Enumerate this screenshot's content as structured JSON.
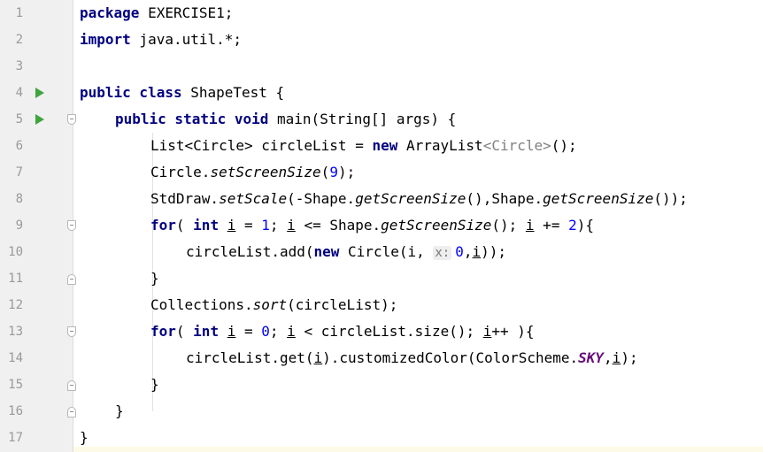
{
  "editor": {
    "language": "java",
    "gutter": {
      "line_numbers": [
        "1",
        "2",
        "3",
        "4",
        "5",
        "6",
        "7",
        "8",
        "9",
        "10",
        "11",
        "12",
        "13",
        "14",
        "15",
        "16",
        "17"
      ],
      "run_markers": [
        "run-icon",
        "run-icon"
      ],
      "fold_markers": [
        "fold-open-icon",
        "fold-open-icon",
        "fold-close-icon",
        "fold-open-icon",
        "fold-close-icon",
        "fold-close-icon",
        "fold-close-icon"
      ]
    },
    "inlay_hint": "x:",
    "code": {
      "l1_kw": "package",
      "l1_rest": " EXERCISE1;",
      "l2_kw": "import",
      "l2_rest": " java.util.*;",
      "l4_kw": "public class",
      "l4_rest": " ShapeTest {",
      "l5_kw": "public static void",
      "l5_rest": " main(String[] args) {",
      "l6_a": "List<Circle> circleList = ",
      "l6_kw": "new",
      "l6_b": " ArrayList",
      "l6_type": "<Circle>",
      "l6_c": "();",
      "l7_a": "Circle.",
      "l7_it": "setScreenSize",
      "l7_b": "(",
      "l7_num": "9",
      "l7_c": ");",
      "l8_a": "StdDraw.",
      "l8_it1": "setScale",
      "l8_b": "(-Shape.",
      "l8_it2": "getScreenSize",
      "l8_c": "(),Shape.",
      "l8_it3": "getScreenSize",
      "l8_d": "());",
      "l9_kw1": "for",
      "l9_a": "( ",
      "l9_kw2": "int",
      "l9_b": " ",
      "l9_var1": "i",
      "l9_c": " = ",
      "l9_num1": "1",
      "l9_d": "; ",
      "l9_var2": "i",
      "l9_e": " <= Shape.",
      "l9_it": "getScreenSize",
      "l9_f": "(); ",
      "l9_var3": "i",
      "l9_g": " += ",
      "l9_num2": "2",
      "l9_h": "){",
      "l10_a": "circleList.add(",
      "l10_kw": "new",
      "l10_b": " Circle(i, ",
      "l10_num": "0",
      "l10_c": ",",
      "l10_var": "i",
      "l10_d": "));",
      "l11": "}",
      "l12_a": "Collections.",
      "l12_it": "sort",
      "l12_b": "(circleList);",
      "l13_kw1": "for",
      "l13_a": "( ",
      "l13_kw2": "int",
      "l13_b": " ",
      "l13_var1": "i",
      "l13_c": " = ",
      "l13_num": "0",
      "l13_d": "; ",
      "l13_var2": "i",
      "l13_e": " < circleList.size(); ",
      "l13_var3": "i",
      "l13_f": "++ ){",
      "l14_a": "circleList.get(",
      "l14_var1": "i",
      "l14_b": ").customizedColor(ColorScheme.",
      "l14_static": "SKY",
      "l14_c": ",",
      "l14_var2": "i",
      "l14_d": ");",
      "l15": "}",
      "l16": "}",
      "l17": "}"
    }
  }
}
